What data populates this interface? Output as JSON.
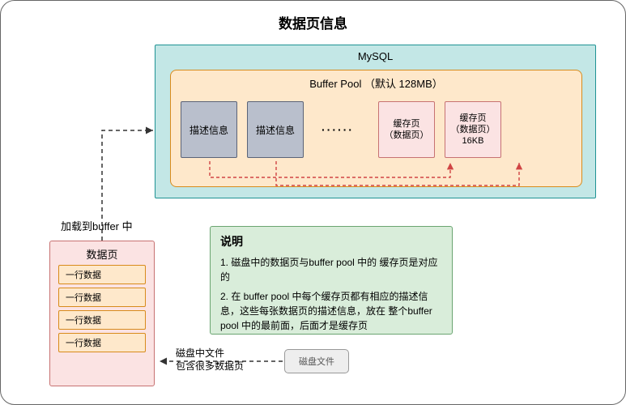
{
  "title": "数据页信息",
  "mysql": {
    "label": "MySQL",
    "buffer_pool": {
      "label": "Buffer Pool （默认 128MB）",
      "desc1": "描述信息",
      "desc2": "描述信息",
      "dots": "······",
      "cache1": {
        "line1": "缓存页",
        "line2": "（数据页）"
      },
      "cache2": {
        "line1": "缓存页",
        "line2": "（数据页）",
        "line3": "16KB"
      }
    }
  },
  "load_label": "加载到buffer 中",
  "datapage": {
    "title": "数据页",
    "rows": [
      "一行数据",
      "一行数据",
      "一行数据",
      "一行数据"
    ]
  },
  "explain": {
    "title": "说明",
    "p1": "1. 磁盘中的数据页与buffer pool 中的 缓存页是对应的",
    "p2": "2. 在 buffer pool 中每个缓存页都有相应的描述信息，这些每张数据页的描述信息，放在 整个buffer pool 中的最前面，后面才是缓存页"
  },
  "disk": {
    "box": "磁盘文件",
    "label1": "磁盘中文件",
    "label2": "包含很多数据页"
  }
}
